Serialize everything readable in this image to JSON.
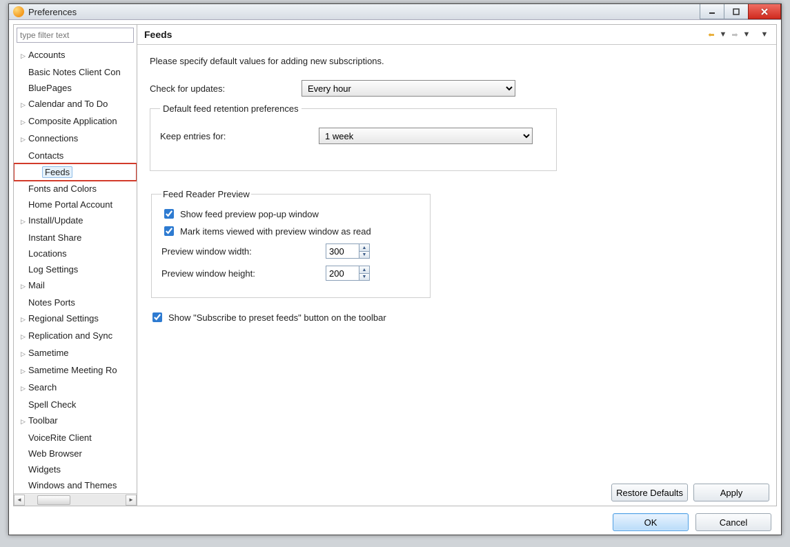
{
  "window": {
    "title": "Preferences"
  },
  "filter": {
    "placeholder": "type filter text"
  },
  "tree": [
    {
      "label": "Accounts",
      "expandable": true
    },
    {
      "label": "Basic Notes Client Con",
      "expandable": false
    },
    {
      "label": "BluePages",
      "expandable": false
    },
    {
      "label": "Calendar and To Do",
      "expandable": true
    },
    {
      "label": "Composite Application",
      "expandable": true
    },
    {
      "label": "Connections",
      "expandable": true
    },
    {
      "label": "Contacts",
      "expandable": false
    },
    {
      "label": "Feeds",
      "expandable": false,
      "selected": true,
      "highlight": true,
      "child": true
    },
    {
      "label": "Fonts and Colors",
      "expandable": false
    },
    {
      "label": "Home Portal Account",
      "expandable": false
    },
    {
      "label": "Install/Update",
      "expandable": true
    },
    {
      "label": "Instant Share",
      "expandable": false
    },
    {
      "label": "Locations",
      "expandable": false
    },
    {
      "label": "Log Settings",
      "expandable": false
    },
    {
      "label": "Mail",
      "expandable": true
    },
    {
      "label": "Notes Ports",
      "expandable": false
    },
    {
      "label": "Regional Settings",
      "expandable": true
    },
    {
      "label": "Replication and Sync",
      "expandable": true
    },
    {
      "label": "Sametime",
      "expandable": true
    },
    {
      "label": "Sametime Meeting Ro",
      "expandable": true
    },
    {
      "label": "Search",
      "expandable": true
    },
    {
      "label": "Spell Check",
      "expandable": false
    },
    {
      "label": "Toolbar",
      "expandable": true
    },
    {
      "label": "VoiceRite Client",
      "expandable": false
    },
    {
      "label": "Web Browser",
      "expandable": false
    },
    {
      "label": "Widgets",
      "expandable": false
    },
    {
      "label": "Windows and Themes",
      "expandable": false
    }
  ],
  "page": {
    "heading": "Feeds",
    "intro": "Please specify default values for adding new subscriptions.",
    "check_updates_label": "Check for updates:",
    "check_updates_value": "Every hour",
    "retention_group": "Default feed retention preferences",
    "keep_entries_label": "Keep entries for:",
    "keep_entries_value": "1 week",
    "preview_group": "Feed Reader Preview",
    "show_popup_label": "Show feed preview pop-up window",
    "show_popup_checked": true,
    "mark_read_label": "Mark items viewed with preview window as read",
    "mark_read_checked": true,
    "width_label": "Preview window width:",
    "width_value": "300",
    "height_label": "Preview window height:",
    "height_value": "200",
    "show_subscribe_label": "Show \"Subscribe to preset feeds\" button on the toolbar",
    "show_subscribe_checked": true
  },
  "buttons": {
    "restore": "Restore Defaults",
    "apply": "Apply",
    "ok": "OK",
    "cancel": "Cancel"
  }
}
